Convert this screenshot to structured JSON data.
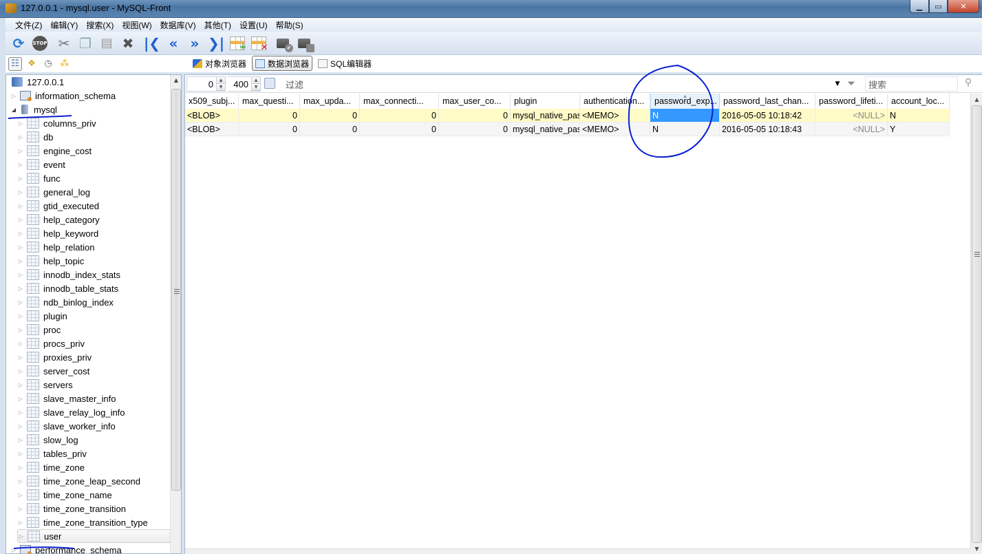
{
  "window": {
    "title": "127.0.0.1 - mysql.user - MySQL-Front",
    "controls": [
      "minimize",
      "maximize",
      "close"
    ]
  },
  "menu": {
    "items": [
      "文件(Z)",
      "编辑(Y)",
      "搜索(X)",
      "视图(W)",
      "数据库(V)",
      "其他(T)",
      "设置(U)",
      "帮助(S)"
    ]
  },
  "toolbar": {
    "buttons": [
      {
        "name": "refresh-icon",
        "glyph": "⟳"
      },
      {
        "name": "stop-icon",
        "glyph": "STOP"
      },
      {
        "name": "cut-icon",
        "glyph": "✂"
      },
      {
        "name": "copy-icon",
        "glyph": "❐"
      },
      {
        "name": "paste-icon",
        "glyph": "📋"
      },
      {
        "name": "delete-icon",
        "glyph": "✖"
      },
      {
        "name": "first-record-icon",
        "glyph": "|◀"
      },
      {
        "name": "previous-record-icon",
        "glyph": "«"
      },
      {
        "name": "next-record-icon",
        "glyph": "»"
      },
      {
        "name": "last-record-icon",
        "glyph": "▶|"
      },
      {
        "name": "insert-record-icon",
        "glyph": "+"
      },
      {
        "name": "delete-record-icon",
        "glyph": "×"
      },
      {
        "name": "post-record-icon",
        "glyph": "✔"
      },
      {
        "name": "cancel-record-icon",
        "glyph": "■"
      }
    ]
  },
  "view_buttons": [
    {
      "name": "tree-view-icon",
      "glyph": "☷"
    },
    {
      "name": "bookmarks-icon",
      "glyph": "✿"
    },
    {
      "name": "history-icon",
      "glyph": "◷"
    },
    {
      "name": "jobs-icon",
      "glyph": "⁂"
    }
  ],
  "tabs": [
    {
      "label": "对象浏览器",
      "active": false
    },
    {
      "label": "数据浏览器",
      "active": true
    },
    {
      "label": "SQL编辑器",
      "active": false
    }
  ],
  "tree": {
    "server": "127.0.0.1",
    "databases_before": [
      "information_schema"
    ],
    "open_database": "mysql",
    "tables": [
      "columns_priv",
      "db",
      "engine_cost",
      "event",
      "func",
      "general_log",
      "gtid_executed",
      "help_category",
      "help_keyword",
      "help_relation",
      "help_topic",
      "innodb_index_stats",
      "innodb_table_stats",
      "ndb_binlog_index",
      "plugin",
      "proc",
      "procs_priv",
      "proxies_priv",
      "server_cost",
      "servers",
      "slave_master_info",
      "slave_relay_log_info",
      "slave_worker_info",
      "slow_log",
      "tables_priv",
      "time_zone",
      "time_zone_leap_second",
      "time_zone_name",
      "time_zone_transition",
      "time_zone_transition_type",
      "user"
    ],
    "selected_table": "user",
    "databases_after": [
      "performance_schema"
    ]
  },
  "filterbar": {
    "offset": "0",
    "limit": "400",
    "filter_placeholder": "过滤",
    "search_placeholder": "搜索"
  },
  "grid": {
    "columns": [
      "x509_subj...",
      "max_questi...",
      "max_upda...",
      "max_connecti...",
      "max_user_co...",
      "plugin",
      "authentication...",
      "password_exp...",
      "password_last_chan...",
      "password_lifeti...",
      "account_loc..."
    ],
    "sorted_column": 7,
    "rows": [
      [
        "<BLOB>",
        "0",
        "0",
        "0",
        "0",
        "mysql_native_pas",
        "<MEMO>",
        "N",
        "2016-05-05 10:18:42",
        "<NULL>",
        "N"
      ],
      [
        "<BLOB>",
        "0",
        "0",
        "0",
        "0",
        "mysql_native_pas",
        "<MEMO>",
        "N",
        "2016-05-05 10:18:43",
        "<NULL>",
        "Y"
      ]
    ],
    "focused_cell": {
      "row": 0,
      "col": 7
    }
  },
  "colors": {
    "selected_row": "#fffbc7",
    "focus_cell": "#3399ff",
    "annotation_ink": "#0a1fd0"
  }
}
